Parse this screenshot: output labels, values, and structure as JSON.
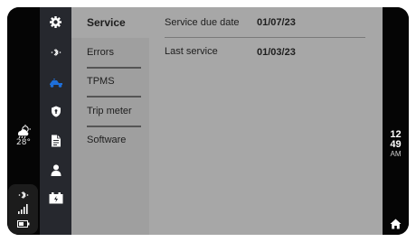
{
  "weather": {
    "icon": "rain-cloud-icon",
    "temperature": "28°"
  },
  "status": {
    "bluetooth_icon": "bluetooth-icon",
    "signal_icon": "signal-icon",
    "battery_icon": "battery-icon"
  },
  "sidebar_icons": [
    "settings-icon",
    "bluetooth-icon",
    "scooter-icon",
    "shield-icon",
    "document-icon",
    "user-icon",
    "battery-card-icon"
  ],
  "menu": {
    "items": [
      {
        "label": "Service",
        "active": true
      },
      {
        "label": "Errors"
      },
      {
        "label": "TPMS"
      },
      {
        "label": "Trip meter"
      },
      {
        "label": "Software"
      }
    ]
  },
  "service": {
    "rows": [
      {
        "label": "Service due date",
        "value": "01/07/23"
      },
      {
        "label": "Last service",
        "value": "01/03/23"
      }
    ]
  },
  "clock": {
    "hour": "12",
    "minute": "49",
    "ampm": "AM"
  },
  "colors": {
    "accent": "#1e6fd9",
    "sidebar_bg": "#26282e",
    "panel_bg": "#a7a7a7"
  }
}
